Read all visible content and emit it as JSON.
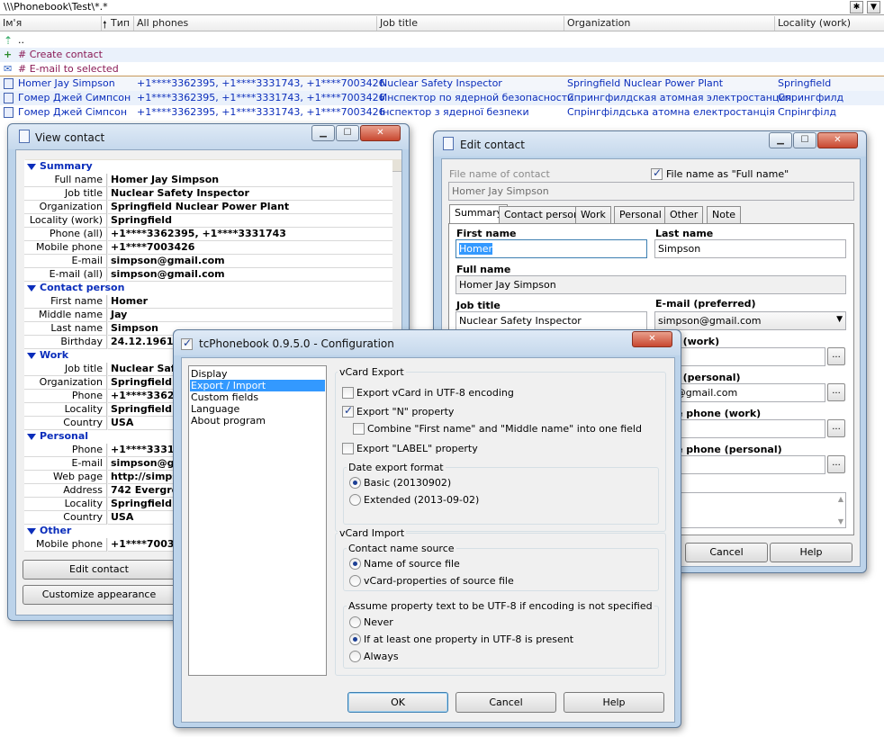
{
  "pathbar": {
    "path": "\\\\\\Phonebook\\Test\\*.*",
    "btn1": "✱",
    "btn2": "▼"
  },
  "columns": [
    {
      "label": "Ім'я"
    },
    {
      "label": "Тип"
    },
    {
      "label": "All phones"
    },
    {
      "label": "Job title"
    },
    {
      "label": "Organization"
    },
    {
      "label": "Locality (work)"
    }
  ],
  "list": {
    "up": "..",
    "create": "# Create contact",
    "email": "# E-mail to selected",
    "rows": [
      {
        "name": "Homer Jay Simpson",
        "phones": "+1****3362395, +1****3331743, +1****7003426",
        "job": "Nuclear Safety Inspector",
        "org": "Springfield Nuclear Power Plant",
        "loc": "Springfield"
      },
      {
        "name": "Гомер Джей Симпсон",
        "phones": "+1****3362395, +1****3331743, +1****7003426",
        "job": "Инспектор по ядерной безопасности",
        "org": "Спрингфилдская атомная электростанция",
        "loc": "Спрингфилд"
      },
      {
        "name": "Гомер Джей Сімпсон",
        "phones": "+1****3362395, +1****3331743, +1****7003426",
        "job": "Інспектор з ядерної безпеки",
        "org": "Спрінгфілдська атомна електростанція",
        "loc": "Спрінгфілд"
      }
    ]
  },
  "view": {
    "title": "View contact",
    "sections": {
      "summary": "Summary",
      "contact": "Contact person",
      "work": "Work",
      "personal": "Personal",
      "other": "Other"
    },
    "summary": [
      {
        "label": "Full name",
        "value": "Homer Jay Simpson"
      },
      {
        "label": "Job title",
        "value": "Nuclear Safety Inspector"
      },
      {
        "label": "Organization",
        "value": "Springfield Nuclear Power Plant"
      },
      {
        "label": "Locality (work)",
        "value": "Springfield"
      },
      {
        "label": "Phone (all)",
        "value": "+1****3362395, +1****3331743"
      },
      {
        "label": "Mobile phone (all)",
        "value": "+1****7003426"
      },
      {
        "label": "E-mail (preferred)",
        "value": "simpson@gmail.com"
      },
      {
        "label": "E-mail (all)",
        "value": "simpson@gmail.com"
      }
    ],
    "contact": [
      {
        "label": "First name",
        "value": "Homer"
      },
      {
        "label": "Middle name",
        "value": "Jay"
      },
      {
        "label": "Last name",
        "value": "Simpson"
      },
      {
        "label": "Birthday",
        "value": "24.12.1961"
      }
    ],
    "work": [
      {
        "label": "Job title",
        "value": "Nuclear Safe"
      },
      {
        "label": "Organization",
        "value": "Springfield N"
      },
      {
        "label": "Phone",
        "value": "+1****3362"
      },
      {
        "label": "Locality",
        "value": "Springfield"
      },
      {
        "label": "Country",
        "value": "USA"
      }
    ],
    "personal": [
      {
        "label": "Phone",
        "value": "+1****3331"
      },
      {
        "label": "E-mail",
        "value": "simpson@gm"
      },
      {
        "label": "Web page",
        "value": "http://simps"
      },
      {
        "label": "Address",
        "value": "742 Evergre"
      },
      {
        "label": "Locality",
        "value": "Springfield"
      },
      {
        "label": "Country",
        "value": "USA"
      }
    ],
    "other": [
      {
        "label": "Mobile phone",
        "value": "+1****7003"
      }
    ],
    "edit_btn": "Edit contact",
    "custom_btn": "Customize appearance"
  },
  "edit": {
    "title": "Edit contact",
    "file_label": "File name of contact",
    "file_value": "Homer Jay Simpson",
    "fullname_check": "File name as \"Full name\"",
    "tabs": [
      "Summary",
      "Contact person",
      "Work",
      "Personal",
      "Other",
      "Note"
    ],
    "first_name_label": "First name",
    "first_name": "Homer",
    "last_name_label": "Last name",
    "last_name": "Simpson",
    "full_name_label": "Full name",
    "full_name": "Homer Jay Simpson",
    "job_label": "Job title",
    "job": "Nuclear Safety Inspector",
    "email_pref_label": "E-mail (preferred)",
    "email_pref": "simpson@gmail.com",
    "email_work_label": "l (work)",
    "email_personal_label": "l (personal)",
    "email_personal": "on@gmail.com",
    "phone_work_label": "e phone (work)",
    "phone_personal_label": "e phone (personal)",
    "cancel": "Cancel",
    "help": "Help"
  },
  "config": {
    "title": "tcPhonebook 0.9.5.0 - Configuration",
    "nav": [
      "Display",
      "Export / Import",
      "Custom fields",
      "Language",
      "About program"
    ],
    "export_group": "vCard Export",
    "utf8": "Export vCard in UTF-8 encoding",
    "n_prop": "Export \"N\" property",
    "combine": "Combine \"First name\" and \"Middle name\" into one field",
    "label_prop": "Export \"LABEL\" property",
    "date_group": "Date export format",
    "date_basic": "Basic (20130902)",
    "date_ext": "Extended (2013-09-02)",
    "import_group": "vCard Import",
    "source_group": "Contact name source",
    "src_file": "Name of source file",
    "src_props": "vCard-properties  of source file",
    "assume_group": "Assume property text to be UTF-8 if encoding is not specified",
    "never": "Never",
    "atleast": "If at least one property in UTF-8 is present",
    "always": "Always",
    "ok": "OK",
    "cancel": "Cancel",
    "help": "Help"
  }
}
